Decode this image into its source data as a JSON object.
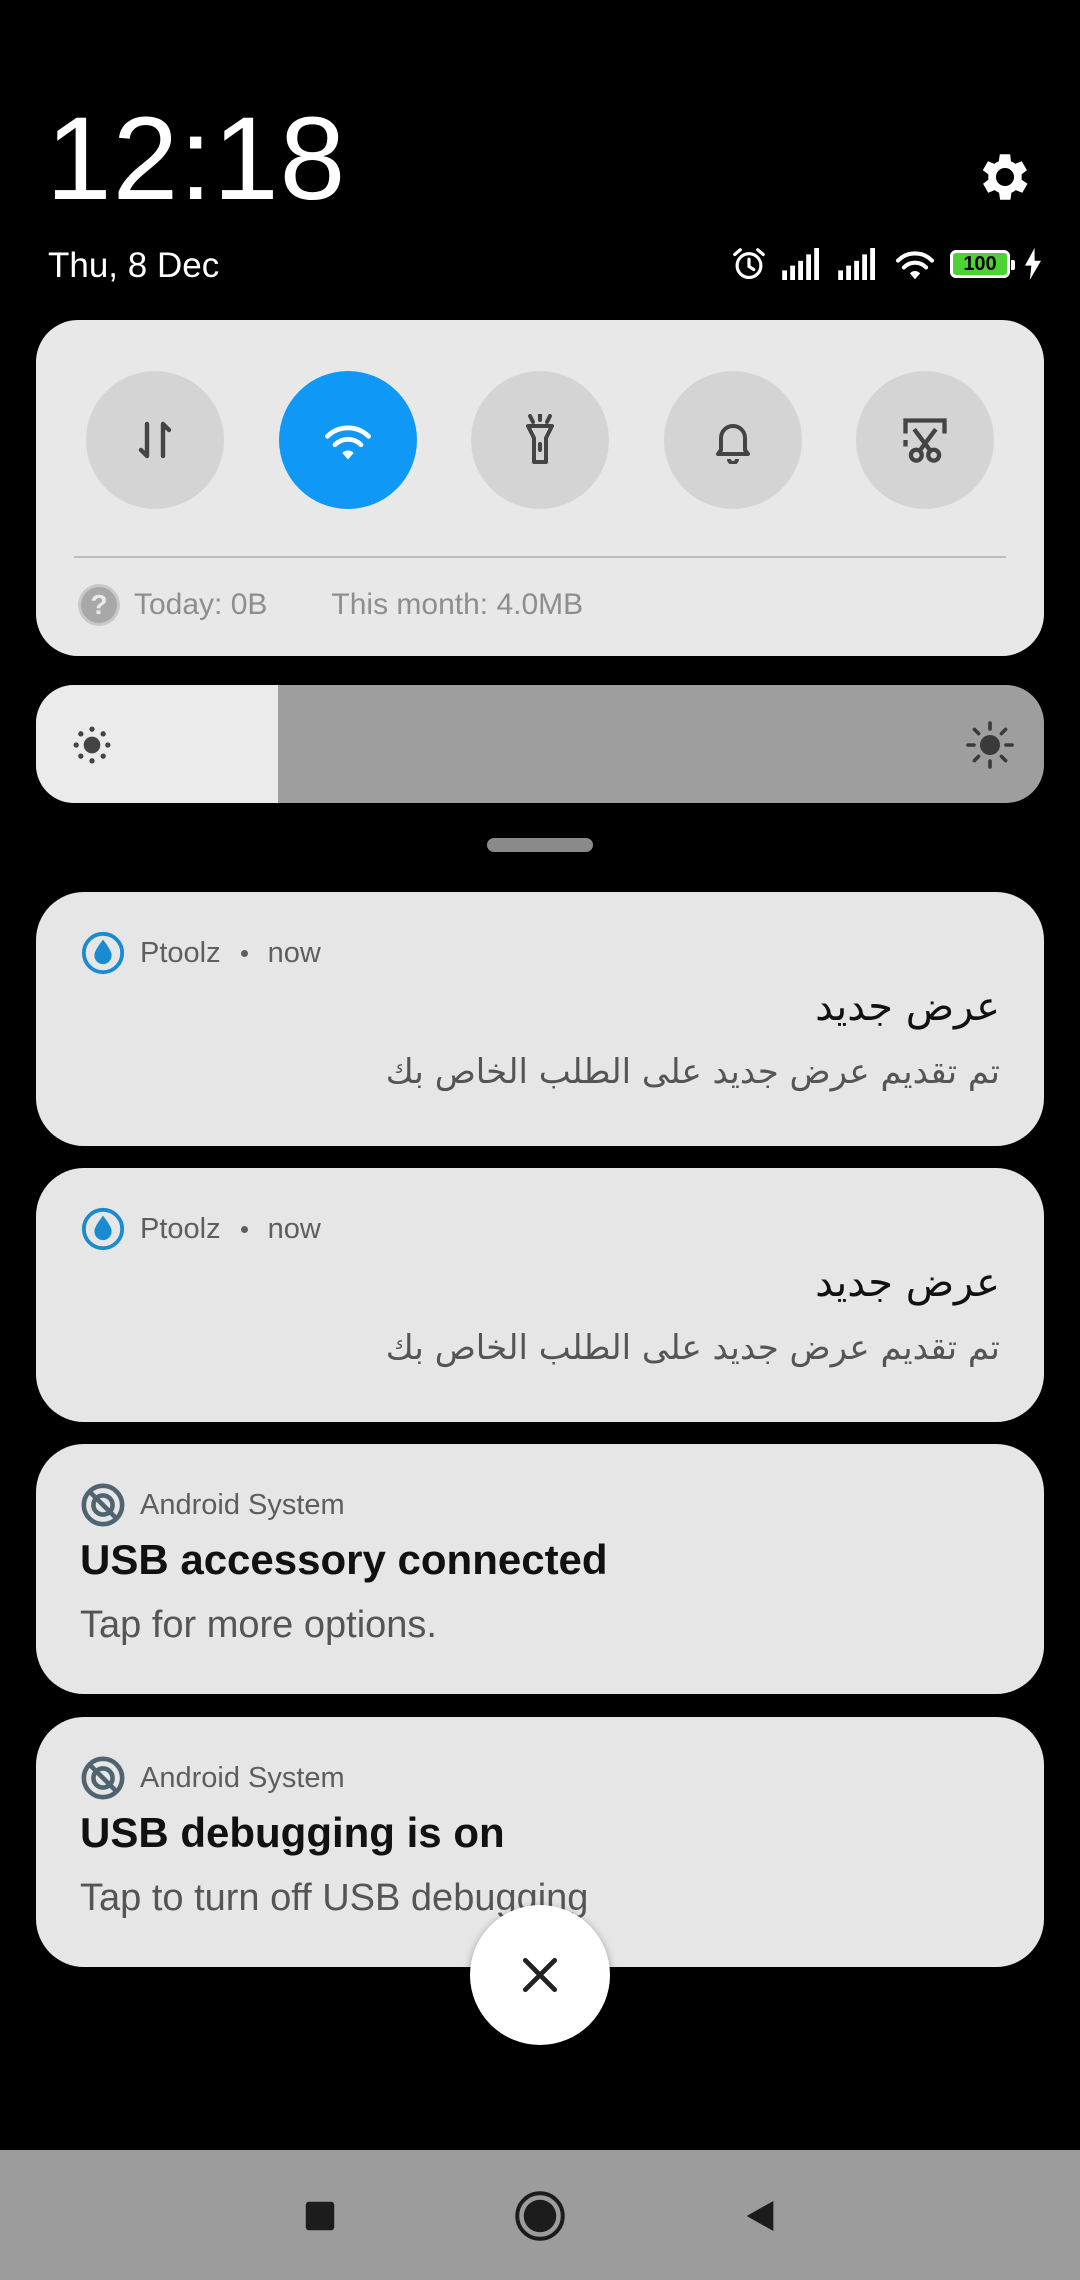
{
  "header": {
    "time": "12:18",
    "date": "Thu, 8 Dec",
    "battery_level": "100",
    "icons": [
      "alarm-icon",
      "signal-icon",
      "signal-icon",
      "wifi-icon",
      "battery-icon",
      "charging-icon"
    ]
  },
  "quick_settings": {
    "toggles": [
      {
        "name": "mobile-data-toggle",
        "icon": "data-arrows-icon",
        "active": false
      },
      {
        "name": "wifi-toggle",
        "icon": "wifi-icon",
        "active": true
      },
      {
        "name": "flashlight-toggle",
        "icon": "flashlight-icon",
        "active": false
      },
      {
        "name": "sound-toggle",
        "icon": "bell-icon",
        "active": false
      },
      {
        "name": "screenshot-toggle",
        "icon": "scissors-screen-icon",
        "active": false
      }
    ],
    "usage_today": "Today: 0B",
    "usage_month": "This month: 4.0MB",
    "active_color": "#0f98f5"
  },
  "brightness": {
    "level": 0.24
  },
  "notifications": [
    {
      "app": "Ptoolz",
      "time": "now",
      "title": "عرض جديد",
      "text": "تم تقديم عرض جديد على الطلب الخاص بك"
    },
    {
      "app": "Ptoolz",
      "time": "now",
      "title": "عرض جديد",
      "text": "تم تقديم عرض جديد على الطلب الخاص بك"
    },
    {
      "app": "Android System",
      "title": "USB accessory connected",
      "text": "Tap for more options."
    },
    {
      "app": "Android System",
      "title": "USB debugging is on",
      "text": "Tap to turn off USB debugging"
    }
  ]
}
